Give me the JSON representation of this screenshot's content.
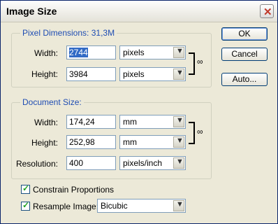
{
  "window": {
    "title": "Image Size",
    "close_glyph": "✕"
  },
  "pixel_dimensions": {
    "legend": "Pixel Dimensions:",
    "size": "31,3M",
    "width_label": "Width:",
    "width_value": "2744",
    "width_unit": "pixels",
    "height_label": "Height:",
    "height_value": "3984",
    "height_unit": "pixels"
  },
  "document_size": {
    "legend": "Document Size:",
    "width_label": "Width:",
    "width_value": "174,24",
    "width_unit": "mm",
    "height_label": "Height:",
    "height_value": "252,98",
    "height_unit": "mm",
    "resolution_label": "Resolution:",
    "resolution_value": "400",
    "resolution_unit": "pixels/inch"
  },
  "options": {
    "constrain_label": "Constrain Proportions",
    "constrain_checked": true,
    "resample_label": "Resample Image:",
    "resample_checked": true,
    "resample_method": "Bicubic"
  },
  "buttons": {
    "ok": "OK",
    "cancel": "Cancel",
    "auto": "Auto..."
  },
  "icons": {
    "link": "chain-link-icon",
    "dropdown": "chevron-down-icon",
    "check": "checkmark-icon"
  }
}
